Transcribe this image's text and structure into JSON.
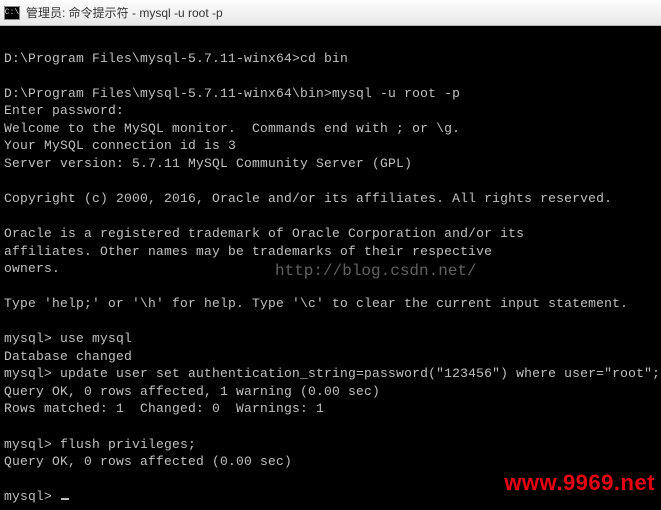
{
  "window": {
    "title": "管理员: 命令提示符 - mysql  -u root -p",
    "icon_label": "C:\\"
  },
  "terminal": {
    "lines": [
      "",
      "D:\\Program Files\\mysql-5.7.11-winx64>cd bin",
      "",
      "D:\\Program Files\\mysql-5.7.11-winx64\\bin>mysql -u root -p",
      "Enter password:",
      "Welcome to the MySQL monitor.  Commands end with ; or \\g.",
      "Your MySQL connection id is 3",
      "Server version: 5.7.11 MySQL Community Server (GPL)",
      "",
      "Copyright (c) 2000, 2016, Oracle and/or its affiliates. All rights reserved.",
      "",
      "Oracle is a registered trademark of Oracle Corporation and/or its",
      "affiliates. Other names may be trademarks of their respective",
      "owners.",
      "",
      "Type 'help;' or '\\h' for help. Type '\\c' to clear the current input statement.",
      "",
      "mysql> use mysql",
      "Database changed",
      "mysql> update user set authentication_string=password(\"123456\") where user=\"root\";",
      "Query OK, 0 rows affected, 1 warning (0.00 sec)",
      "Rows matched: 1  Changed: 0  Warnings: 1",
      "",
      "mysql> flush privileges;",
      "Query OK, 0 rows affected (0.00 sec)",
      "",
      "mysql>"
    ]
  },
  "watermarks": {
    "blog": "http://blog.csdn.net/",
    "site": "www.9969.net"
  }
}
